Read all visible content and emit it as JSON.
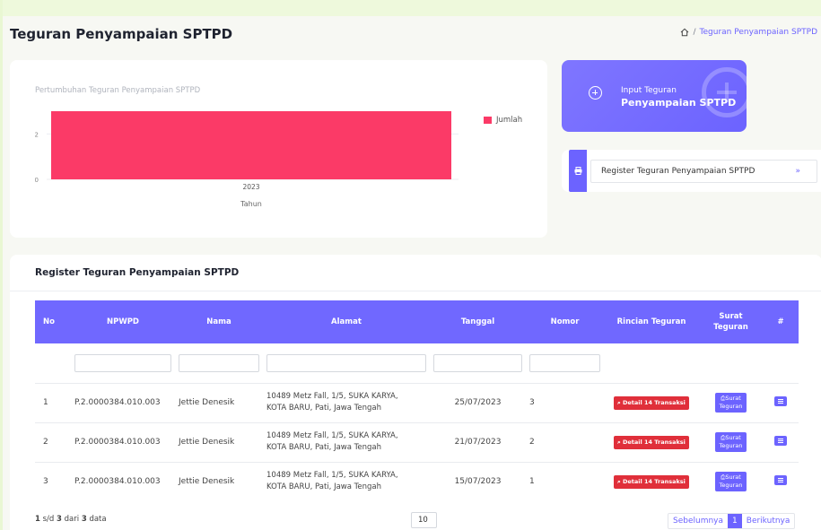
{
  "page": {
    "title": "Teguran Penyampaian SPTPD",
    "breadcrumb_current": "Teguran Penyampaian SPTPD"
  },
  "chart_card": {
    "chart_data": {
      "type": "bar",
      "title": "Pertumbuhan Teguran Penyampaian SPTPD",
      "categories": [
        "2023"
      ],
      "series": [
        {
          "name": "Jumlah",
          "values": [
            3
          ],
          "color": "#fb3a67"
        }
      ],
      "legend_label": "Jumlah",
      "xlabel": "Tahun",
      "ylabel": "",
      "y_ticks": [
        0,
        2
      ],
      "ylim": [
        0,
        3
      ],
      "legend_position": "top-right",
      "grid": true
    }
  },
  "input_tile": {
    "line1": "Input Teguran",
    "line2": "Penyampaian SPTPD",
    "icon": "plus-circle-icon"
  },
  "register_tile": {
    "label": "Register Teguran Penyampaian SPTPD",
    "chevron": "»",
    "icon": "printer-icon"
  },
  "table": {
    "heading": "Register Teguran Penyampaian SPTPD",
    "columns": [
      "No",
      "NPWPD",
      "Nama",
      "Alamat",
      "Tanggal",
      "Nomor",
      "Rincian Teguran",
      "Surat Teguran",
      "#"
    ],
    "rows": [
      {
        "no": "1",
        "npwpd": "P.2.0000384.010.003",
        "nama": "Jettie Denesik",
        "alamat_1": "10489 Metz Fall, 1/5, SUKA KARYA,",
        "alamat_2": "KOTA BARU, Pati, Jawa Tengah",
        "tanggal": "25/07/2023",
        "nomor": "3",
        "rincian": "Detail 14 Transaksi",
        "surat_1": "Surat",
        "surat_2": "Teguran"
      },
      {
        "no": "2",
        "npwpd": "P.2.0000384.010.003",
        "nama": "Jettie Denesik",
        "alamat_1": "10489 Metz Fall, 1/5, SUKA KARYA,",
        "alamat_2": "KOTA BARU, Pati, Jawa Tengah",
        "tanggal": "21/07/2023",
        "nomor": "2",
        "rincian": "Detail 14 Transaksi",
        "surat_1": "Surat",
        "surat_2": "Teguran"
      },
      {
        "no": "3",
        "npwpd": "P.2.0000384.010.003",
        "nama": "Jettie Denesik",
        "alamat_1": "10489 Metz Fall, 1/5, SUKA KARYA,",
        "alamat_2": "KOTA BARU, Pati, Jawa Tengah",
        "tanggal": "15/07/2023",
        "nomor": "1",
        "rincian": "Detail 14 Transaksi",
        "surat_1": "Surat",
        "surat_2": "Teguran"
      }
    ]
  },
  "footer": {
    "from": "1",
    "sd": "s/d",
    "to": "3",
    "dari": "dari",
    "total": "3",
    "data": "data",
    "page_size": "10",
    "prev": "Sebelumnya",
    "current_page": "1",
    "next": "Berikutnya"
  },
  "colors": {
    "accent": "#6c63ff",
    "bar": "#fb3a67",
    "danger": "#e02f3a"
  }
}
